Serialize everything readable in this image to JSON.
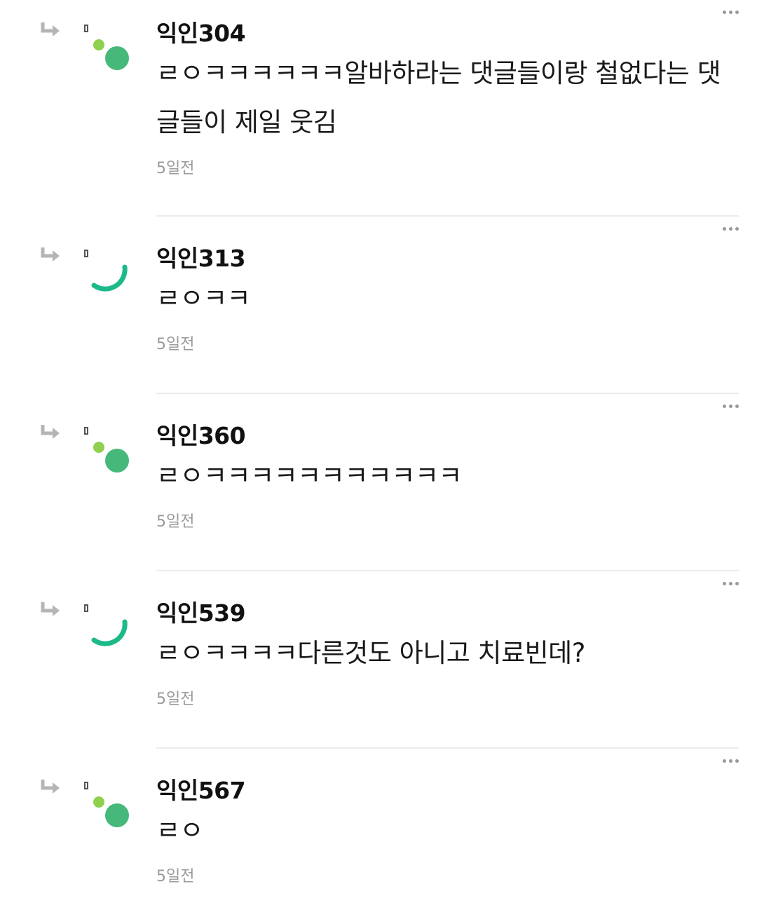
{
  "comments": [
    {
      "nickname": "익인304",
      "text": "ㄹㅇㅋㅋㅋㅋㅋㅋ알바하라는 댓글들이랑 철없다는 댓글들이 제일 웃김",
      "time": "5일전",
      "avatar_style": "dots"
    },
    {
      "nickname": "익인313",
      "text": "ㄹㅇㅋㅋ",
      "time": "5일전",
      "avatar_style": "arc"
    },
    {
      "nickname": "익인360",
      "text": "ㄹㅇㅋㅋㅋㅋㅋㅋㅋㅋㅋㅋㅋ",
      "time": "5일전",
      "avatar_style": "dots"
    },
    {
      "nickname": "익인539",
      "text": "ㄹㅇㅋㅋㅋㅋ다른것도 아니고 치료빈데?",
      "time": "5일전",
      "avatar_style": "arc"
    },
    {
      "nickname": "익인567",
      "text": "ㄹㅇ",
      "time": "5일전",
      "avatar_style": "dots"
    }
  ],
  "icons": {
    "reply": "reply-arrow-icon",
    "more": "more-options-icon"
  },
  "colors": {
    "avatar_green": "#46b97a",
    "avatar_lime": "#8fd14f",
    "avatar_arc": "#1db98a",
    "time_gray": "#9a9a9a",
    "divider": "#ececec"
  }
}
